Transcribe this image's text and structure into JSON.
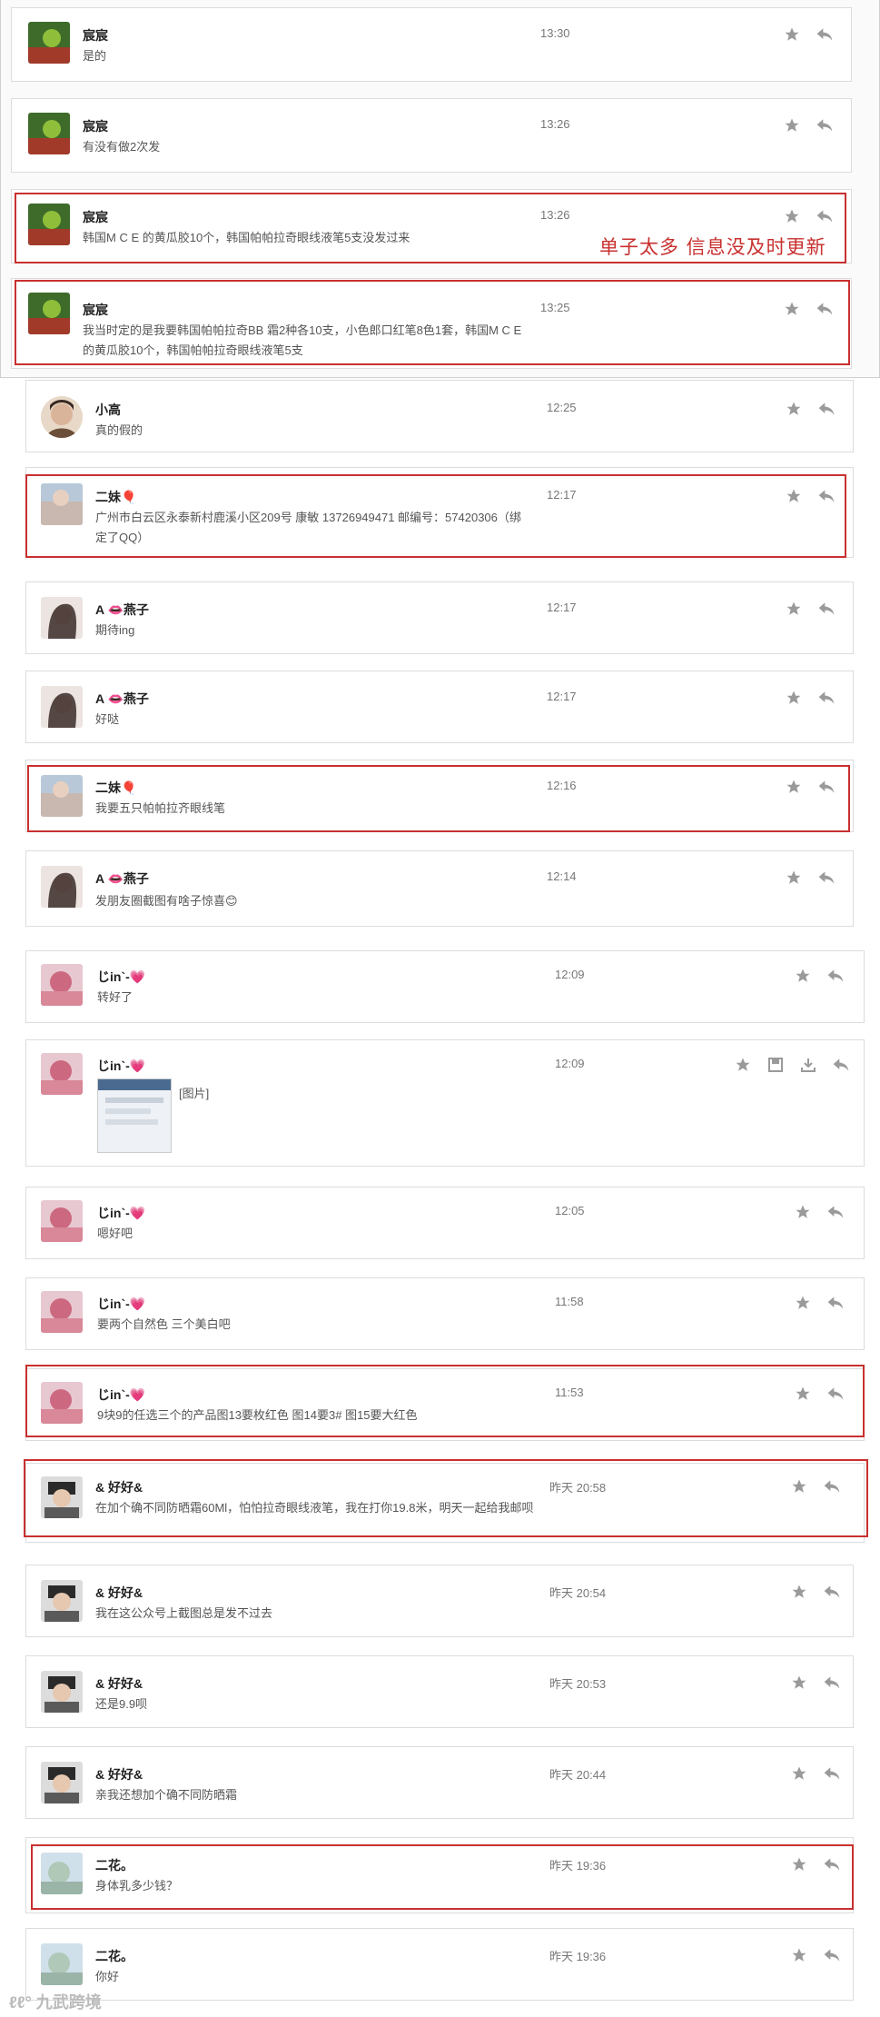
{
  "colors": {
    "highlight": "#c8302f",
    "icon": "#9a9a9a",
    "border": "#dcdcdc"
  },
  "annotation": "单子太多  信息没及时更新",
  "messages": [
    {
      "name": "宸宸",
      "text": "是的",
      "time": "13:30"
    },
    {
      "name": "宸宸",
      "text": "有没有做2次发",
      "time": "13:26"
    },
    {
      "name": "宸宸",
      "text": "韩国M C E 的黄瓜胶10个，韩国帕帕拉奇眼线液笔5支没发过来",
      "time": "13:26"
    },
    {
      "name": "宸宸",
      "text": "我当时定的是我要韩国帕帕拉奇BB 霜2种各10支，小色郎口红笔8色1套，韩国M C E 的黄瓜胶10个，韩国帕帕拉奇眼线液笔5支",
      "time": "13:25"
    },
    {
      "name": "小高",
      "text": "真的假的",
      "time": "12:25"
    },
    {
      "name": "二妹🎈",
      "text": "广州市白云区永泰新村鹿溪小区209号 康敏 13726949471 邮编号：57420306（绑定了QQ）",
      "time": "12:17"
    },
    {
      "name": "A 👄燕子",
      "text": "期待ing",
      "time": "12:17"
    },
    {
      "name": "A 👄燕子",
      "text": "好哒",
      "time": "12:17"
    },
    {
      "name": "二妹🎈",
      "text": "我要五只帕帕拉齐眼线笔",
      "time": "12:16"
    },
    {
      "name": "A 👄燕子",
      "text": "发朋友圈截图有啥子惊喜😊",
      "time": "12:14"
    },
    {
      "name": "じin`-💗",
      "text": "转好了",
      "time": "12:09"
    },
    {
      "name": "じin`-💗",
      "text": "[图片]",
      "time": "12:09"
    },
    {
      "name": "じin`-💗",
      "text": "嗯好吧",
      "time": "12:05"
    },
    {
      "name": "じin`-💗",
      "text": "要两个自然色 三个美白吧",
      "time": "11:58"
    },
    {
      "name": "じin`-💗",
      "text": "9块9的任选三个的产品图13要枚红色 图14要3# 图15要大红色",
      "time": "11:53"
    },
    {
      "name": "& 好好&",
      "text": "在加个确不同防晒霜60Ml，怕怕拉奇眼线液笔，我在打你19.8米，明天一起给我邮呗",
      "time": "昨天 20:58"
    },
    {
      "name": "& 好好&",
      "text": "我在这公众号上截图总是发不过去",
      "time": "昨天 20:54"
    },
    {
      "name": "& 好好&",
      "text": "还是9.9呗",
      "time": "昨天 20:53"
    },
    {
      "name": "& 好好&",
      "text": "亲我还想加个确不同防晒霜",
      "time": "昨天 20:44"
    },
    {
      "name": "二花。",
      "text": "身体乳多少钱？",
      "time": "昨天 19:36"
    },
    {
      "name": "二花。",
      "text": "你好",
      "time": "昨天 19:36"
    }
  ],
  "watermark": "ℓℓ° 九武跨境"
}
